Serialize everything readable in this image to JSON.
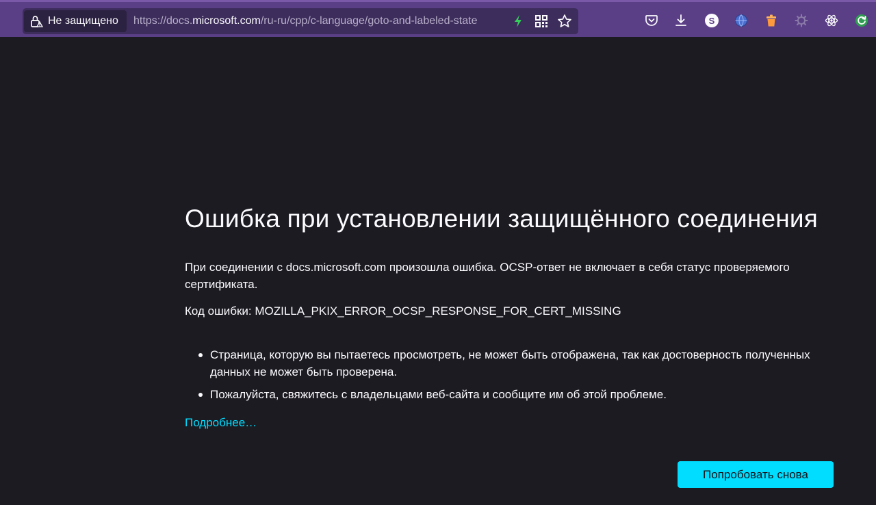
{
  "browser": {
    "identity_label": "Не защищено",
    "url_prefix": "https://docs.",
    "url_host": "microsoft.com",
    "url_rest": "/ru-ru/cpp/c-language/goto-and-labeled-state",
    "icons": {
      "lock": "lock-warning-icon",
      "lightning": "lightning-icon",
      "qr": "qr-code-icon",
      "bookmark": "bookmark-star-icon",
      "pocket": "pocket-icon",
      "downloads": "download-icon",
      "ext_s": "extension-s-icon",
      "ext_globe": "extension-globe-icon",
      "ext_trash": "extension-trash-icon",
      "ext_gear": "extension-gear-icon",
      "ext_react": "extension-react-icon",
      "ext_refresh": "extension-refresh-icon"
    },
    "ext_s_letter": "S"
  },
  "error": {
    "title": "Ошибка при установлении защищённого соединения",
    "description": "При соединении с docs.microsoft.com произошла ошибка. OCSP-ответ не включает в себя статус проверяемого сертификата.",
    "code_label": "Код ошибки: MOZILLA_PKIX_ERROR_OCSP_RESPONSE_FOR_CERT_MISSING",
    "bullets": [
      "Страница, которую вы пытаетесь просмотреть, не может быть отображена, так как достоверность полученных данных не может быть проверена.",
      "Пожалуйста, свяжитесь с владельцами веб-сайта и сообщите им об этой проблеме."
    ],
    "more_link": "Подробнее…",
    "retry_button": "Попробовать снова"
  },
  "colors": {
    "toolbar": "#5b3f86",
    "page_bg": "#1c1b22",
    "accent": "#00ddff",
    "text": "#fbfbfe"
  }
}
